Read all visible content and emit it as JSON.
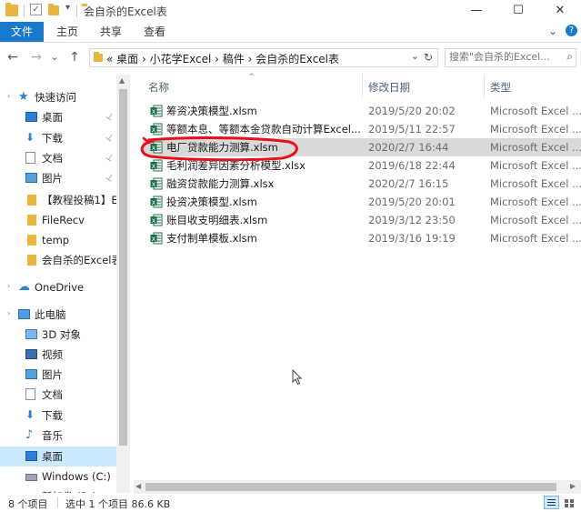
{
  "window": {
    "title": "会自杀的Excel表",
    "controls": {
      "minimize": "—",
      "maximize": "☐",
      "close": "✕"
    },
    "qat_dropdown": "▾"
  },
  "ribbon": {
    "tabs": [
      "文件",
      "主页",
      "共享",
      "查看"
    ],
    "collapse": "⌄",
    "help": "?"
  },
  "nav": {
    "back": "←",
    "forward": "→",
    "recent": "⌄",
    "up": "↑"
  },
  "address": {
    "text": "«  桌面  ›  小花学Excel  ›  稿件  ›  会自杀的Excel表",
    "dropdown": "⌄",
    "refresh": "↻"
  },
  "search": {
    "placeholder": "搜索\"会自杀的Excel...",
    "icon": "⌕"
  },
  "sidebar": {
    "items": [
      {
        "label": "快速访问",
        "icon": "star-icon",
        "pinned": false
      },
      {
        "label": "桌面",
        "icon": "desktop-icon",
        "pinned": true
      },
      {
        "label": "下载",
        "icon": "download-icon",
        "pinned": true
      },
      {
        "label": "文档",
        "icon": "document-icon",
        "pinned": true
      },
      {
        "label": "图片",
        "icon": "picture-icon",
        "pinned": true
      },
      {
        "label": "【教程投稿1】E",
        "icon": "folder-icon",
        "pinned": false
      },
      {
        "label": "FileRecv",
        "icon": "folder-icon",
        "pinned": false
      },
      {
        "label": "temp",
        "icon": "folder-icon",
        "pinned": false
      },
      {
        "label": "会自杀的Excel表",
        "icon": "folder-icon",
        "pinned": false
      },
      {
        "label": "OneDrive",
        "icon": "cloud-icon",
        "pinned": false
      },
      {
        "label": "此电脑",
        "icon": "computer-icon",
        "pinned": false
      },
      {
        "label": "3D 对象",
        "icon": "cube-icon",
        "pinned": false
      },
      {
        "label": "视频",
        "icon": "video-icon",
        "pinned": false
      },
      {
        "label": "图片",
        "icon": "picture-icon",
        "pinned": false
      },
      {
        "label": "文档",
        "icon": "document-icon",
        "pinned": false
      },
      {
        "label": "下载",
        "icon": "download-icon",
        "pinned": false
      },
      {
        "label": "音乐",
        "icon": "music-icon",
        "pinned": false
      },
      {
        "label": "桌面",
        "icon": "desktop-icon",
        "pinned": false
      },
      {
        "label": "Windows (C:)",
        "icon": "drive-icon",
        "pinned": false
      },
      {
        "label": "新加卷 (D:)",
        "icon": "drive-icon",
        "pinned": false
      }
    ],
    "pin_glyph": "📌"
  },
  "columns": {
    "name": "名称",
    "date": "修改日期",
    "type": "类型",
    "sort_glyph": "^"
  },
  "files": [
    {
      "name": "筹资决策模型.xlsm",
      "date": "2019/5/20 20:02",
      "type": "Microsoft Excel ..."
    },
    {
      "name": "等额本息、等额本金贷款自动计算Excel...",
      "date": "2019/5/11 22:57",
      "type": "Microsoft Excel ..."
    },
    {
      "name": "电厂贷款能力测算.xlsm",
      "date": "2020/2/7 16:44",
      "type": "Microsoft Excel ..."
    },
    {
      "name": "毛利润差异因素分析模型.xlsx",
      "date": "2019/6/18 22:44",
      "type": "Microsoft Excel ..."
    },
    {
      "name": "融资贷款能力测算.xlsx",
      "date": "2020/2/7 16:15",
      "type": "Microsoft Excel ..."
    },
    {
      "name": "投资决策模型.xlsm",
      "date": "2019/5/20 20:01",
      "type": "Microsoft Excel ..."
    },
    {
      "name": "账目收支明细表.xlsm",
      "date": "2019/3/12 23:50",
      "type": "Microsoft Excel ..."
    },
    {
      "name": "支付制单模板.xlsm",
      "date": "2019/3/16 19:19",
      "type": "Microsoft Excel ..."
    }
  ],
  "status": {
    "item_count": "8 个项目",
    "selection": "选中 1 个项目  86.6 KB"
  },
  "colors": {
    "file_tab": "#1979ca",
    "selected_nav": "#cce8ff",
    "selected_row": "#d9d9d9",
    "annotation": "#e8101a",
    "excel_green": "#1d7044"
  }
}
